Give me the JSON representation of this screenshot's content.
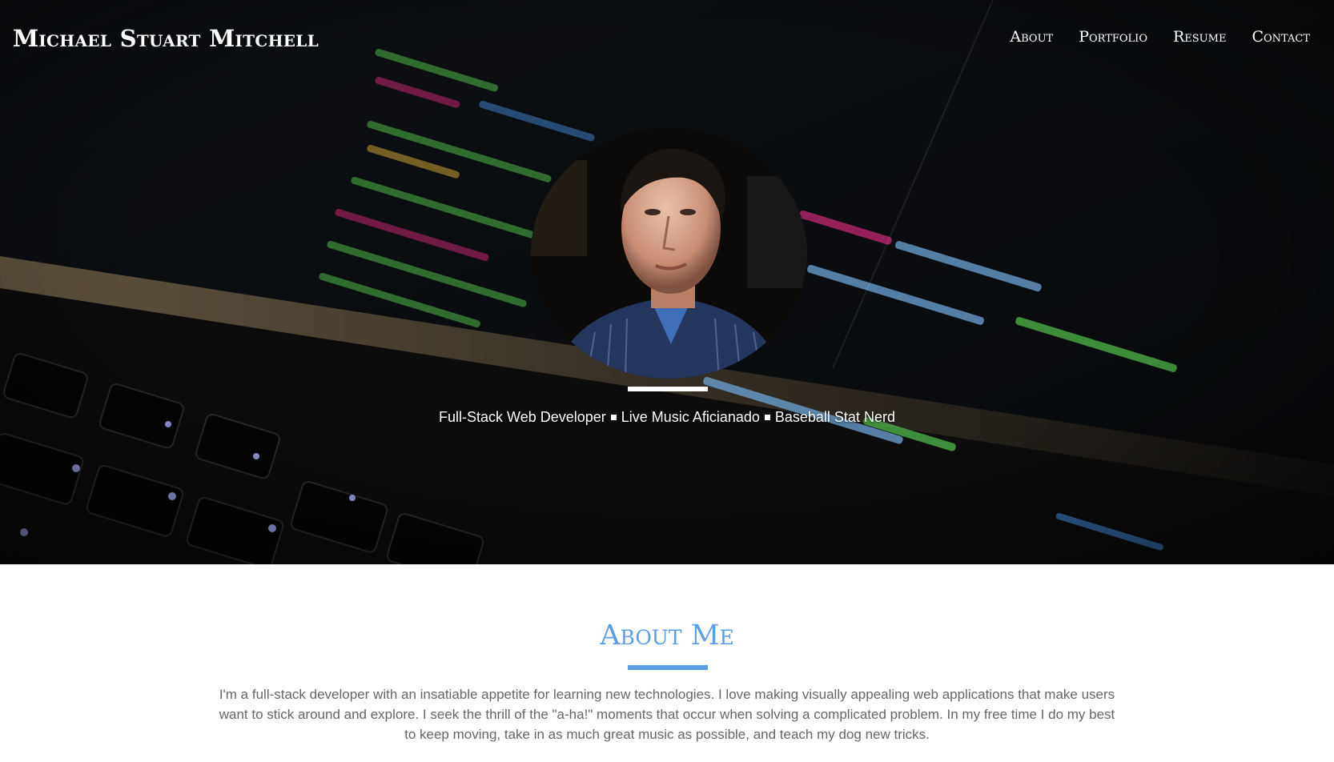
{
  "header": {
    "brand": "Michael Stuart Mitchell",
    "nav": [
      {
        "label": "About"
      },
      {
        "label": "Portfolio"
      },
      {
        "label": "Resume"
      },
      {
        "label": "Contact"
      }
    ]
  },
  "hero": {
    "taglines": [
      "Full-Stack Web Developer",
      "Live Music Aficianado",
      "Baseball Stat Nerd"
    ]
  },
  "about": {
    "title": "About Me",
    "body": "I'm a full-stack developer with an insatiable appetite for learning new technologies. I love making visually appealing web applications that make users want to stick around and explore. I seek the thrill of the \"a-ha!\" moments that occur when solving a complicated problem. In my free time I do my best to keep moving, take in as much great music as possible, and teach my dog new tricks."
  },
  "colors": {
    "accent": "#5b9ee6",
    "hero_text": "#ffffff",
    "body_text": "#666666"
  }
}
